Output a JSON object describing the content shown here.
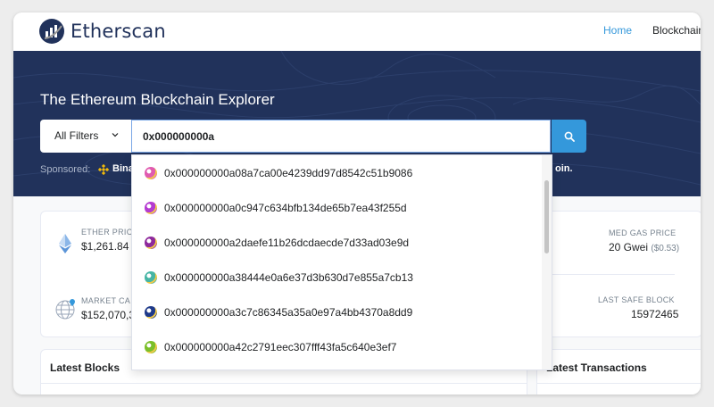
{
  "header": {
    "logo_text": "Etherscan",
    "nav": {
      "home": "Home",
      "blockchain": "Blockchain"
    }
  },
  "hero": {
    "title": "The Ethereum Blockchain Explorer",
    "search": {
      "filter_label": "All Filters",
      "value": "0x000000000a"
    },
    "sponsored_label": "Sponsored:",
    "sponsored_text": "Bina",
    "sponsored_tail": "oin."
  },
  "stats": {
    "ether_price_label": "ETHER PRIC",
    "ether_price_value": "$1,261.84",
    "market_cap_label": "MARKET CA",
    "market_cap_value": "$152,070,3",
    "med_gas_label": "MED GAS PRICE",
    "med_gas_value": "20 Gwei",
    "med_gas_sub": "($0.53)",
    "last_safe_label": "LAST SAFE BLOCK",
    "last_safe_value": "15972465"
  },
  "cards": {
    "latest_blocks": "Latest Blocks",
    "latest_transactions": "Latest Transactions"
  },
  "suggestions": [
    {
      "address": "0x000000000a08a7ca00e4239dd97d8542c51b9086",
      "avatar_color": "#e05bb0"
    },
    {
      "address": "0x000000000a0c947c634bfb134de65b7ea43f255d",
      "avatar_color": "#b43bd1"
    },
    {
      "address": "0x000000000a2daefe11b26dcdaecde7d33ad03e9d",
      "avatar_color": "#8e2a9c"
    },
    {
      "address": "0x000000000a38444e0a6e37d3b630d7e855a7cb13",
      "avatar_color": "#46b5a5"
    },
    {
      "address": "0x000000000a3c7c86345a35a0e97a4bb4370a8dd9",
      "avatar_color": "#1f3a8a"
    },
    {
      "address": "0x000000000a42c2791eec307fff43fa5c640e3ef7",
      "avatar_color": "#7bbf2a"
    }
  ],
  "colors": {
    "brand_navy": "#21325b",
    "accent_blue": "#3498db",
    "binance_yellow": "#f0b90b"
  }
}
